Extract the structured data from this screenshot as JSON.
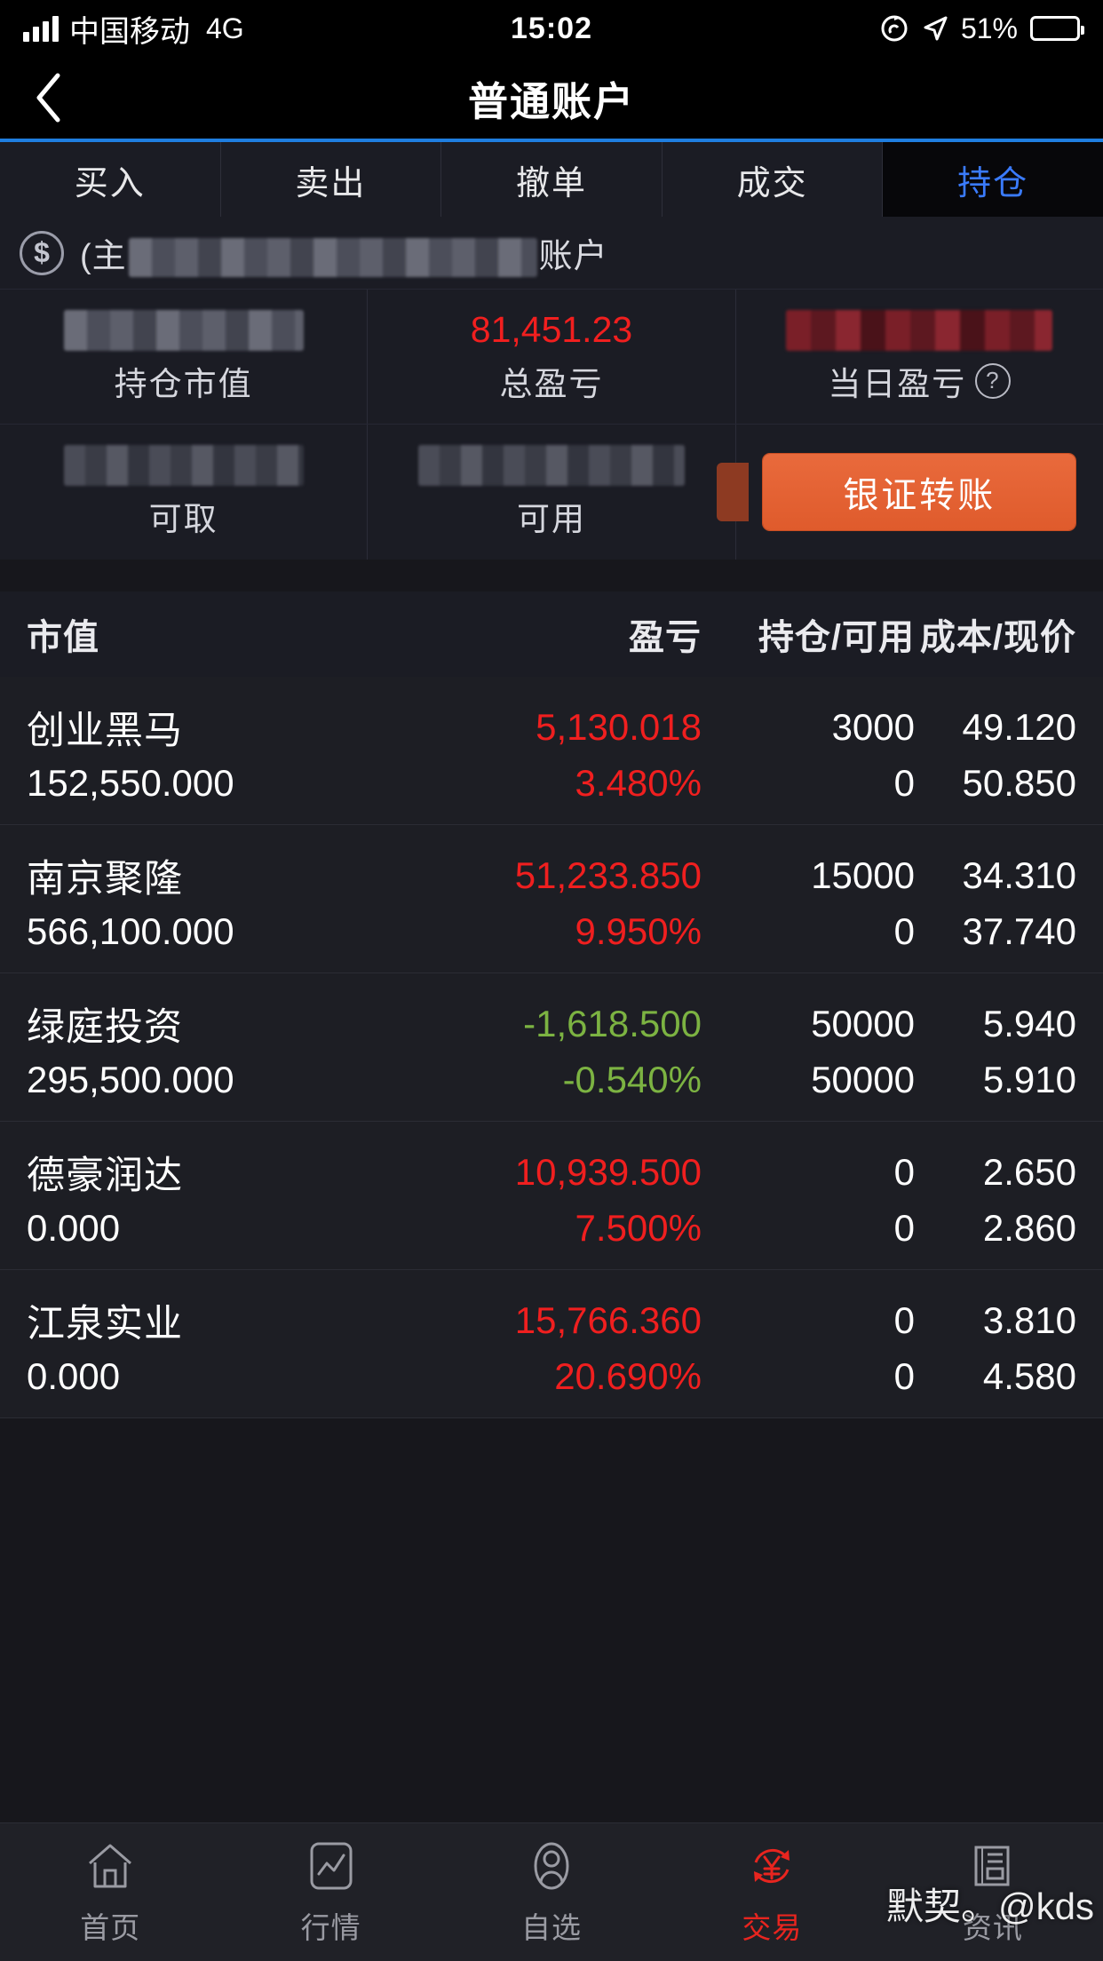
{
  "status_bar": {
    "carrier": "中国移动",
    "network": "4G",
    "time": "15:02",
    "battery_percent": "51%",
    "battery_level": 51
  },
  "nav": {
    "title": "普通账户",
    "back_icon": "chevron-left-icon"
  },
  "tabs": [
    {
      "label": "买入",
      "active": false
    },
    {
      "label": "卖出",
      "active": false
    },
    {
      "label": "撤单",
      "active": false
    },
    {
      "label": "成交",
      "active": false
    },
    {
      "label": "持仓",
      "active": true
    }
  ],
  "account": {
    "icon": "dollar-circle-icon",
    "prefix": "(主",
    "suffix": "账户",
    "redacted": true
  },
  "summary": {
    "row1": [
      {
        "label": "持仓市值",
        "value": "",
        "redacted": true,
        "color": "neutral"
      },
      {
        "label": "总盈亏",
        "value": "81,451.23",
        "redacted": false,
        "color": "red"
      },
      {
        "label": "当日盈亏",
        "value": "",
        "redacted": true,
        "color": "red",
        "help_icon": "question-mark-icon"
      }
    ],
    "row2": [
      {
        "label": "可取",
        "value": "",
        "redacted": true
      },
      {
        "label": "可用",
        "value": "",
        "redacted": true
      }
    ],
    "transfer_button": "银证转账"
  },
  "table": {
    "headers": [
      "市值",
      "盈亏",
      "持仓/可用",
      "成本/现价"
    ],
    "rows": [
      {
        "name": "创业黑马",
        "market_value": "152,550.000",
        "profit": "5,130.018",
        "profit_pct": "3.480%",
        "direction": "up",
        "position": "3000",
        "available": "0",
        "cost": "49.120",
        "price": "50.850"
      },
      {
        "name": "南京聚隆",
        "market_value": "566,100.000",
        "profit": "51,233.850",
        "profit_pct": "9.950%",
        "direction": "up",
        "position": "15000",
        "available": "0",
        "cost": "34.310",
        "price": "37.740"
      },
      {
        "name": "绿庭投资",
        "market_value": "295,500.000",
        "profit": "-1,618.500",
        "profit_pct": "-0.540%",
        "direction": "down",
        "position": "50000",
        "available": "50000",
        "cost": "5.940",
        "price": "5.910"
      },
      {
        "name": "德豪润达",
        "market_value": "0.000",
        "profit": "10,939.500",
        "profit_pct": "7.500%",
        "direction": "up",
        "position": "0",
        "available": "0",
        "cost": "2.650",
        "price": "2.860"
      },
      {
        "name": "江泉实业",
        "market_value": "0.000",
        "profit": "15,766.360",
        "profit_pct": "20.690%",
        "direction": "up",
        "position": "0",
        "available": "0",
        "cost": "3.810",
        "price": "4.580"
      }
    ]
  },
  "bottom_nav": [
    {
      "label": "首页",
      "icon": "home-icon",
      "active": false
    },
    {
      "label": "行情",
      "icon": "chart-icon",
      "active": false
    },
    {
      "label": "自选",
      "icon": "person-icon",
      "active": false
    },
    {
      "label": "交易",
      "icon": "yuan-refresh-icon",
      "active": true
    },
    {
      "label": "资讯",
      "icon": "news-icon",
      "active": false
    }
  ],
  "watermark": "默契。@kds",
  "colors": {
    "up_red": "#f01f1f",
    "down_green": "#7cb342",
    "accent_blue": "#3a7bfd",
    "tab_underline": "#1f7ee0",
    "transfer_orange": "#df5b2c",
    "active_nav_red": "#e8251f"
  }
}
